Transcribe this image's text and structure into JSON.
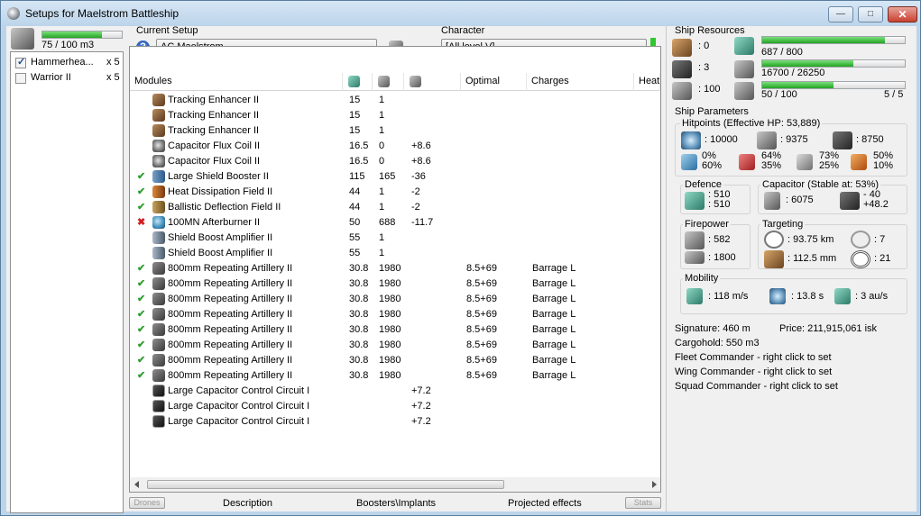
{
  "window": {
    "title": "Setups for Maelstrom Battleship",
    "minimize": "—",
    "maximize": "□",
    "close": "✕"
  },
  "drones": {
    "bay_used": "75 / 100 m3",
    "bay_fill": 0.75,
    "items": [
      {
        "name": "Hammerhea...",
        "count": "x 5",
        "checked": true
      },
      {
        "name": "Warrior II",
        "count": "x 5",
        "checked": false
      }
    ]
  },
  "setup": {
    "label": "Current Setup",
    "value": "AC Maelstrom"
  },
  "character": {
    "label": "Character",
    "value": "[All level V]"
  },
  "modules": {
    "headers": [
      "Modules",
      "",
      "",
      "",
      "Optimal",
      "Charges",
      "Heat"
    ],
    "rows": [
      {
        "status": "",
        "icon": "te",
        "name": "Tracking Enhancer II",
        "cpu": "15",
        "pg": "1",
        "cap": "",
        "optimal": "",
        "charges": ""
      },
      {
        "status": "",
        "icon": "te",
        "name": "Tracking Enhancer II",
        "cpu": "15",
        "pg": "1",
        "cap": "",
        "optimal": "",
        "charges": ""
      },
      {
        "status": "",
        "icon": "te",
        "name": "Tracking Enhancer II",
        "cpu": "15",
        "pg": "1",
        "cap": "",
        "optimal": "",
        "charges": ""
      },
      {
        "status": "",
        "icon": "cfc",
        "name": "Capacitor Flux Coil II",
        "cpu": "16.5",
        "pg": "0",
        "cap": "+8.6",
        "optimal": "",
        "charges": ""
      },
      {
        "status": "",
        "icon": "cfc",
        "name": "Capacitor Flux Coil II",
        "cpu": "16.5",
        "pg": "0",
        "cap": "+8.6",
        "optimal": "",
        "charges": ""
      },
      {
        "status": "ok",
        "icon": "lsb",
        "name": "Large Shield Booster II",
        "cpu": "115",
        "pg": "165",
        "cap": "-36",
        "optimal": "",
        "charges": ""
      },
      {
        "status": "ok",
        "icon": "hdf",
        "name": "Heat Dissipation Field II",
        "cpu": "44",
        "pg": "1",
        "cap": "-2",
        "optimal": "",
        "charges": ""
      },
      {
        "status": "ok",
        "icon": "bdf",
        "name": "Ballistic Deflection Field II",
        "cpu": "44",
        "pg": "1",
        "cap": "-2",
        "optimal": "",
        "charges": ""
      },
      {
        "status": "err",
        "icon": "ab",
        "name": "100MN Afterburner II",
        "cpu": "50",
        "pg": "688",
        "cap": "-11.7",
        "optimal": "",
        "charges": ""
      },
      {
        "status": "",
        "icon": "sba",
        "name": "Shield Boost Amplifier II",
        "cpu": "55",
        "pg": "1",
        "cap": "",
        "optimal": "",
        "charges": ""
      },
      {
        "status": "",
        "icon": "sba",
        "name": "Shield Boost Amplifier II",
        "cpu": "55",
        "pg": "1",
        "cap": "",
        "optimal": "",
        "charges": ""
      },
      {
        "status": "ok",
        "icon": "art",
        "name": "800mm Repeating Artillery II",
        "cpu": "30.8",
        "pg": "1980",
        "cap": "",
        "optimal": "8.5+69",
        "charges": "Barrage L"
      },
      {
        "status": "ok",
        "icon": "art",
        "name": "800mm Repeating Artillery II",
        "cpu": "30.8",
        "pg": "1980",
        "cap": "",
        "optimal": "8.5+69",
        "charges": "Barrage L"
      },
      {
        "status": "ok",
        "icon": "art",
        "name": "800mm Repeating Artillery II",
        "cpu": "30.8",
        "pg": "1980",
        "cap": "",
        "optimal": "8.5+69",
        "charges": "Barrage L"
      },
      {
        "status": "ok",
        "icon": "art",
        "name": "800mm Repeating Artillery II",
        "cpu": "30.8",
        "pg": "1980",
        "cap": "",
        "optimal": "8.5+69",
        "charges": "Barrage L"
      },
      {
        "status": "ok",
        "icon": "art",
        "name": "800mm Repeating Artillery II",
        "cpu": "30.8",
        "pg": "1980",
        "cap": "",
        "optimal": "8.5+69",
        "charges": "Barrage L"
      },
      {
        "status": "ok",
        "icon": "art",
        "name": "800mm Repeating Artillery II",
        "cpu": "30.8",
        "pg": "1980",
        "cap": "",
        "optimal": "8.5+69",
        "charges": "Barrage L"
      },
      {
        "status": "ok",
        "icon": "art",
        "name": "800mm Repeating Artillery II",
        "cpu": "30.8",
        "pg": "1980",
        "cap": "",
        "optimal": "8.5+69",
        "charges": "Barrage L"
      },
      {
        "status": "ok",
        "icon": "art",
        "name": "800mm Repeating Artillery II",
        "cpu": "30.8",
        "pg": "1980",
        "cap": "",
        "optimal": "8.5+69",
        "charges": "Barrage L"
      },
      {
        "status": "",
        "icon": "ccc",
        "name": "Large Capacitor Control Circuit I",
        "cpu": "",
        "pg": "",
        "cap": "+7.2",
        "optimal": "",
        "charges": ""
      },
      {
        "status": "",
        "icon": "ccc",
        "name": "Large Capacitor Control Circuit I",
        "cpu": "",
        "pg": "",
        "cap": "+7.2",
        "optimal": "",
        "charges": ""
      },
      {
        "status": "",
        "icon": "ccc",
        "name": "Large Capacitor Control Circuit I",
        "cpu": "",
        "pg": "",
        "cap": "+7.2",
        "optimal": "",
        "charges": ""
      }
    ]
  },
  "bottom_tabs": {
    "left_button": "Drones",
    "description": "Description",
    "boosters": "Boosters\\Implants",
    "projected": "Projected effects",
    "right_button": "Stats"
  },
  "resources": {
    "title": "Ship Resources",
    "hi_slots": ": 0",
    "med_slots": ": 3",
    "launchers": ": 100",
    "cpu": "687 / 800",
    "cpu_fill": 0.86,
    "pg": "16700 / 26250",
    "pg_fill": 0.64,
    "calibration": "50 / 100",
    "calibration_fill": 0.5,
    "rigs": "5 / 5"
  },
  "params": {
    "title": "Ship Parameters",
    "hitpoints_title": "Hitpoints (Effective HP: 53,889)",
    "shield_hp": ": 10000",
    "armor_hp": ": 9375",
    "structure_hp": ": 8750",
    "em": [
      "0%",
      "60%"
    ],
    "thermal": [
      "64%",
      "35%"
    ],
    "kinetic": [
      "73%",
      "25%"
    ],
    "explosive": [
      "50%",
      "10%"
    ],
    "defence_title": "Defence",
    "defence_values": [
      ": 510",
      ": 510"
    ],
    "capacitor_title": "Capacitor (Stable at: 53%)",
    "capacitor_amount": ": 6075",
    "capacitor_delta": [
      "- 40",
      "+48.2"
    ],
    "firepower_title": "Firepower",
    "dps": ": 582",
    "volley": ": 1800",
    "targeting_title": "Targeting",
    "target_range": ": 93.75 km",
    "max_targets": ": 7",
    "scan_res": ": 112.5 mm",
    "sensor_strength": ": 21",
    "mobility_title": "Mobility",
    "velocity": ": 118 m/s",
    "align_time": ": 13.8 s",
    "warp_speed": ": 3 au/s",
    "signature": "Signature: 460 m",
    "price": "Price: 211,915,061 isk",
    "cargohold": "Cargohold: 550 m3",
    "fleet_commander": "Fleet Commander - right click to set",
    "wing_commander": "Wing Commander - right click to set",
    "squad_commander": "Squad Commander - right click to set"
  }
}
